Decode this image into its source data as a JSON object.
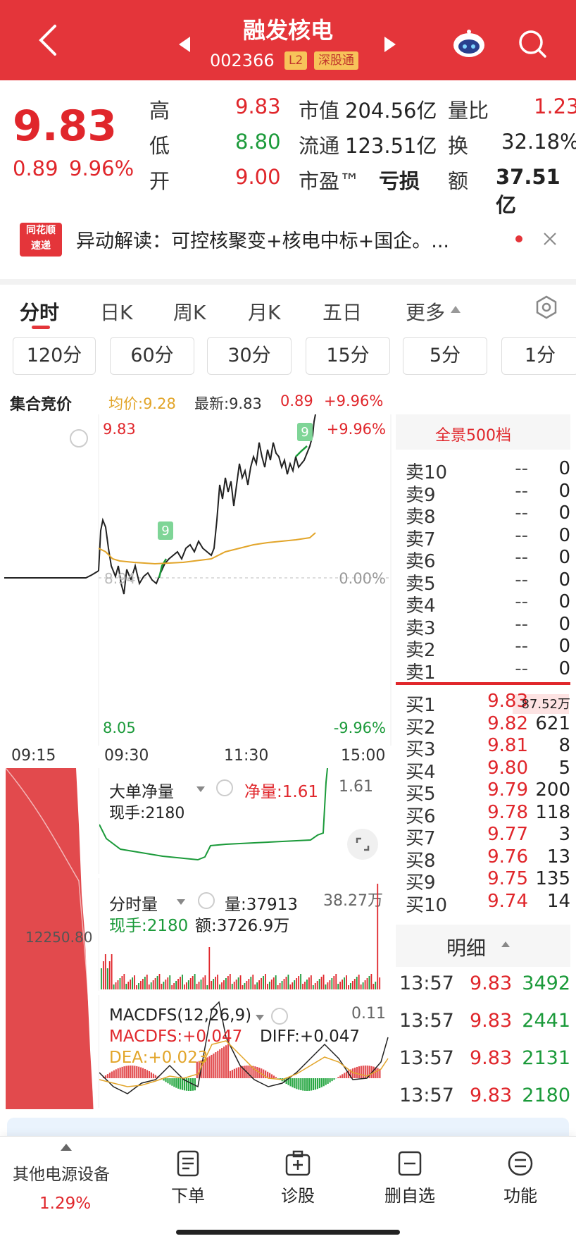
{
  "header": {
    "title": "融发核电",
    "code": "002366",
    "badge_l2": "L2",
    "badge_market": "深股通",
    "icons": [
      "back-arrow",
      "prev-stock",
      "next-stock",
      "robot-assistant",
      "search"
    ]
  },
  "quote": {
    "price": "9.83",
    "change": "0.89",
    "change_pct": "9.96%",
    "high_label": "高",
    "high": "9.83",
    "low_label": "低",
    "low": "8.80",
    "open_label": "开",
    "open": "9.00",
    "mcap_label": "市值",
    "mcap": "204.56亿",
    "float_label": "流通",
    "float": "123.51亿",
    "pe_label": "市盈™",
    "pe": "亏损",
    "vol_ratio_label": "量比",
    "vol_ratio": "1.23",
    "turnover_label": "换",
    "turnover": "32.18%",
    "amount_label": "额",
    "amount": "37.51亿"
  },
  "news": {
    "logo_top": "同花顺",
    "logo_bottom": "速递",
    "text": "异动解读：可控核聚变+核电中标+国企。..."
  },
  "tabs": [
    "分时",
    "日K",
    "周K",
    "月K",
    "五日",
    "更多"
  ],
  "periods": [
    "120分",
    "60分",
    "30分",
    "15分",
    "5分",
    "1分"
  ],
  "chart_header": {
    "auction": "集合竞价",
    "avg": "均价:9.28",
    "latest": "最新:9.83",
    "chg": "0.89",
    "pct": "+9.96%"
  },
  "chart_data": {
    "type": "line",
    "y_top_label": "9.83",
    "y_bottom_label": "8.05",
    "pct_top": "+9.96%",
    "pct_mid": "0.00%",
    "pct_bottom": "-9.96%",
    "mid_label": "8.94",
    "time_labels": [
      "09:15",
      "09:30",
      "11:30",
      "15:00"
    ],
    "marker": "9",
    "ylim": [
      8.05,
      9.83
    ]
  },
  "indicators": {
    "big_order": {
      "name": "大单净量",
      "net_label": "净量:1.61",
      "current": "现手:2180",
      "max": "1.61"
    },
    "volume": {
      "name": "分时量",
      "vol": "量:37913",
      "current": "现手:2180",
      "amount": "额:3726.9万",
      "max": "38.27万"
    },
    "macd": {
      "name": "MACDFS(12,26,9)",
      "macd": "MACDFS:+0.047",
      "diff": "DIFF:+0.047",
      "dea": "DEA:+0.023",
      "max": "0.11"
    },
    "auction_vol": "12250.80"
  },
  "orderbook": {
    "title": "全景500档",
    "sells": [
      {
        "n": "卖10",
        "p": "--",
        "v": "0"
      },
      {
        "n": "卖9",
        "p": "--",
        "v": "0"
      },
      {
        "n": "卖8",
        "p": "--",
        "v": "0"
      },
      {
        "n": "卖7",
        "p": "--",
        "v": "0"
      },
      {
        "n": "卖6",
        "p": "--",
        "v": "0"
      },
      {
        "n": "卖5",
        "p": "--",
        "v": "0"
      },
      {
        "n": "卖4",
        "p": "--",
        "v": "0"
      },
      {
        "n": "卖3",
        "p": "--",
        "v": "0"
      },
      {
        "n": "卖2",
        "p": "--",
        "v": "0"
      },
      {
        "n": "卖1",
        "p": "--",
        "v": "0"
      }
    ],
    "buys": [
      {
        "n": "买1",
        "p": "9.83",
        "v": "87.52万"
      },
      {
        "n": "买2",
        "p": "9.82",
        "v": "621"
      },
      {
        "n": "买3",
        "p": "9.81",
        "v": "8"
      },
      {
        "n": "买4",
        "p": "9.80",
        "v": "5"
      },
      {
        "n": "买5",
        "p": "9.79",
        "v": "200"
      },
      {
        "n": "买6",
        "p": "9.78",
        "v": "118"
      },
      {
        "n": "买7",
        "p": "9.77",
        "v": "3"
      },
      {
        "n": "买8",
        "p": "9.76",
        "v": "13"
      },
      {
        "n": "买9",
        "p": "9.75",
        "v": "135"
      },
      {
        "n": "买10",
        "p": "9.74",
        "v": "14"
      }
    ]
  },
  "ticks": {
    "title": "明细",
    "rows": [
      {
        "t": "13:57",
        "p": "9.83",
        "v": "3492"
      },
      {
        "t": "13:57",
        "p": "9.83",
        "v": "2441"
      },
      {
        "t": "13:57",
        "p": "9.83",
        "v": "2131"
      },
      {
        "t": "13:57",
        "p": "9.83",
        "v": "2180"
      }
    ]
  },
  "bottombar": {
    "sector_name": "其他电源设备",
    "sector_pct": "1.29%",
    "items": [
      "下单",
      "诊股",
      "删自选",
      "功能"
    ]
  },
  "colors": {
    "brand": "#e4353a",
    "up": "#e0262b",
    "down": "#1b9a3a",
    "avg_line": "#e2a52a"
  }
}
